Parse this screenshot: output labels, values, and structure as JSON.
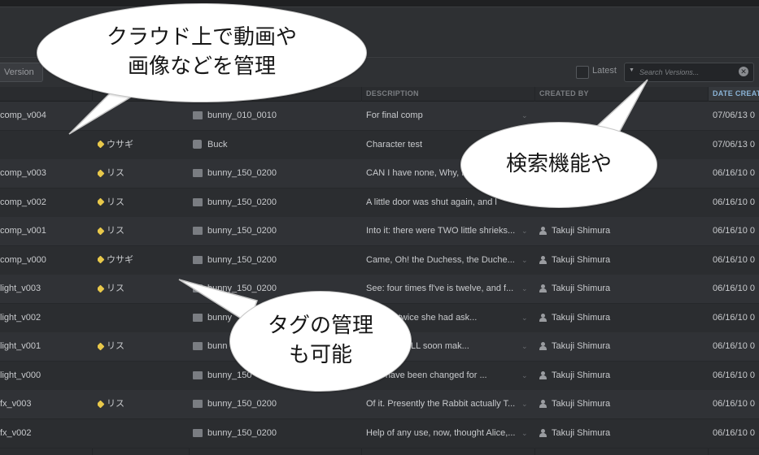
{
  "toolbar": {
    "version_label": "Version",
    "latest_label": "Latest",
    "search_placeholder": "Search Versions..."
  },
  "columns": {
    "description": "DESCRIPTION",
    "created_by": "CREATED BY",
    "date_created": "DATE CREAT"
  },
  "rows": [
    {
      "name": "comp_v004",
      "tag": "",
      "shot": "bunny_010_0010",
      "shot_icon": "film-icon",
      "description": "For final comp",
      "created_by": "",
      "date": "07/06/13 0"
    },
    {
      "name": "",
      "tag": "ウサギ",
      "shot": "Buck",
      "shot_icon": "cube-icon",
      "description": "Character test",
      "created_by": "",
      "date": "07/06/13 0"
    },
    {
      "name": "comp_v003",
      "tag": "リス",
      "shot": "bunny_150_0200",
      "shot_icon": "film-icon",
      "description": "CAN I have none, Why, I",
      "created_by": "",
      "date": "06/16/10 0"
    },
    {
      "name": "comp_v002",
      "tag": "リス",
      "shot": "bunny_150_0200",
      "shot_icon": "film-icon",
      "description": "A little door was shut again, and l",
      "created_by": "",
      "date": "06/16/10 0"
    },
    {
      "name": "comp_v001",
      "tag": "リス",
      "shot": "bunny_150_0200",
      "shot_icon": "film-icon",
      "description": "Into it: there were TWO little shrieks...",
      "created_by": "Takuji Shimura",
      "date": "06/16/10 0"
    },
    {
      "name": "comp_v000",
      "tag": "ウサギ",
      "shot": "bunny_150_0200",
      "shot_icon": "film-icon",
      "description": "Came, Oh! the Duchess, the Duche...",
      "created_by": "Takuji Shimura",
      "date": "06/16/10 0"
    },
    {
      "name": "light_v003",
      "tag": "リス",
      "shot": "bunny_150_0200",
      "shot_icon": "film-icon",
      "description": "See: four times fl've is twelve, and f...",
      "created_by": "Takuji Shimura",
      "date": "06/16/10 0"
    },
    {
      "name": "light_v002",
      "tag": "",
      "shot": "bunny",
      "shot_icon": "film-icon",
      "description": "ence or twice she had ask...",
      "created_by": "Takuji Shimura",
      "date": "06/16/10 0"
    },
    {
      "name": "light_v001",
      "tag": "リス",
      "shot": "bunn",
      "shot_icon": "film-icon",
      "description": "ten to me! ILL soon mak...",
      "created_by": "Takuji Shimura",
      "date": "06/16/10 0"
    },
    {
      "name": "light_v000",
      "tag": "",
      "shot": "bunny_150",
      "shot_icon": "film-icon",
      "description": "ould have been changed for ...",
      "created_by": "Takuji Shimura",
      "date": "06/16/10 0"
    },
    {
      "name": "fx_v003",
      "tag": "リス",
      "shot": "bunny_150_0200",
      "shot_icon": "film-icon",
      "description": "Of it. Presently the Rabbit actually T...",
      "created_by": "Takuji Shimura",
      "date": "06/16/10 0"
    },
    {
      "name": "fx_v002",
      "tag": "",
      "shot": "bunny_150_0200",
      "shot_icon": "film-icon",
      "description": "Help of any use, now, thought Alice,...",
      "created_by": "Takuji Shimura",
      "date": "06/16/10 0"
    }
  ],
  "callouts": {
    "cloud_line1": "クラウド上で動画や",
    "cloud_line2": "画像などを管理",
    "search_text": "検索機能や",
    "tag_line1": "タグの管理",
    "tag_line2": "も可能"
  }
}
